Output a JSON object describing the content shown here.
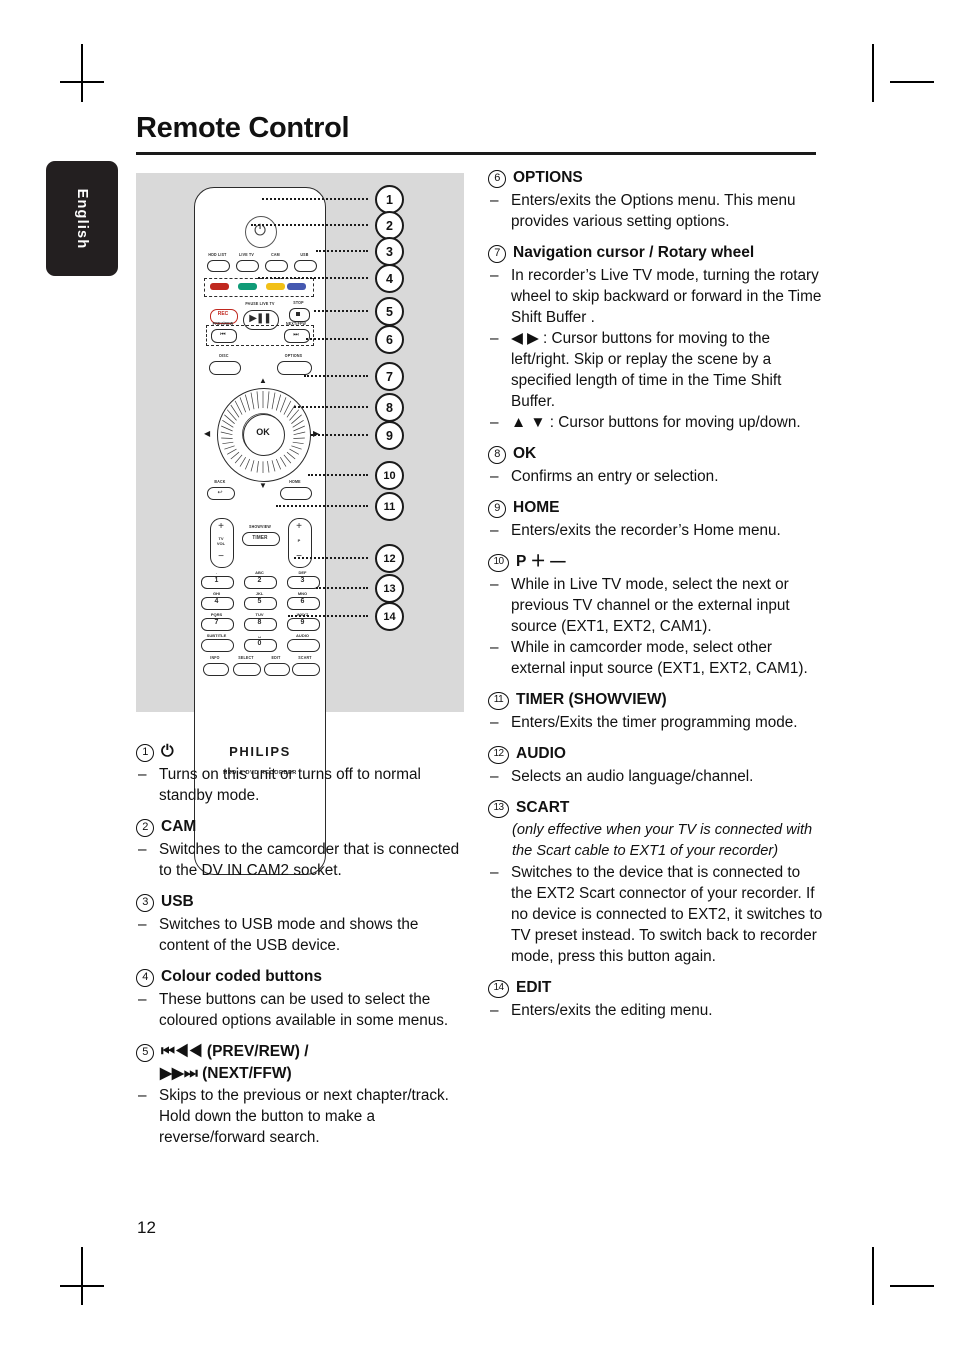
{
  "page": {
    "title": "Remote Control",
    "side_tab": "English",
    "number": "12"
  },
  "remote": {
    "brand": "PHILIPS",
    "model_line": "HDD & DVD RECORDER",
    "power_icon": "power-icon",
    "mode_buttons": [
      "HDD LIST",
      "LIVE TV",
      "CAM",
      "USB"
    ],
    "colour_buttons": [
      "#c0281f",
      "#0f9b77",
      "#f2c017",
      "#4558b0"
    ],
    "transport": {
      "rec": "REC",
      "pause_live_tv": "PAUSE LIVE TV",
      "stop": "STOP",
      "prev_rew": "PREV/REW",
      "next_ffw": "NEXT/FFW"
    },
    "disc": "DISC",
    "options": "OPTIONS",
    "ok": "OK",
    "back": "BACK",
    "home": "HOME",
    "tv_vol": "TV VOL",
    "showview": "SHOWVIEW",
    "timer": "TIMER",
    "prog": "P",
    "plus": "+",
    "minus": "−",
    "keypad": [
      {
        "digit": "1",
        "alpha": "."
      },
      {
        "digit": "2",
        "alpha": "ABC"
      },
      {
        "digit": "3",
        "alpha": "DEF"
      },
      {
        "digit": "4",
        "alpha": "GHI"
      },
      {
        "digit": "5",
        "alpha": "JKL"
      },
      {
        "digit": "6",
        "alpha": "MNO"
      },
      {
        "digit": "7",
        "alpha": "PQRS"
      },
      {
        "digit": "8",
        "alpha": "TUV"
      },
      {
        "digit": "9",
        "alpha": "WXYZ"
      },
      {
        "digit": "0",
        "alpha": "␣"
      }
    ],
    "subtitle": "SUBTITLE",
    "audio": "AUDIO",
    "info": "INFO",
    "select": "SELECT",
    "edit": "EDIT",
    "scart": "SCART"
  },
  "callouts": [
    "1",
    "2",
    "3",
    "4",
    "5",
    "6",
    "7",
    "8",
    "9",
    "10",
    "11",
    "12",
    "13",
    "14"
  ],
  "left_column": [
    {
      "num": "1",
      "title": "⏻",
      "title_is_glyph": true,
      "bullets": [
        "Turns on this unit or turns off to normal standby mode."
      ]
    },
    {
      "num": "2",
      "title": "CAM",
      "bullets": [
        "Switches to the camcorder that is connected to the DV IN CAM2 socket."
      ]
    },
    {
      "num": "3",
      "title": "USB",
      "bullets": [
        "Switches to USB mode and shows the content of the USB device."
      ]
    },
    {
      "num": "4",
      "title": "Colour coded buttons",
      "bullets": [
        "These buttons can be used to select the coloured options available in some menus."
      ]
    },
    {
      "num": "5",
      "title": "⏮◀◀  (PREV/REW) /",
      "title2": "▶▶⏭ (NEXT/FFW)",
      "bullets": [
        "Skips to the previous or next chapter/track. Hold down the button to make a reverse/forward search."
      ]
    }
  ],
  "right_column": [
    {
      "num": "6",
      "title": "OPTIONS",
      "bullets": [
        "Enters/exits the Options menu.  This menu provides various setting options."
      ]
    },
    {
      "num": "7",
      "title": "Navigation cursor / Rotary wheel",
      "bullets": [
        "In recorder’s Live TV mode, turning the rotary wheel to skip backward or forward in the Time Shift Buffer .",
        "◀ ▶ : Cursor buttons for moving to the left/right. Skip or replay the scene by a specified length of time in the Time Shift Buffer.",
        "▲ ▼ : Cursor buttons for moving up/down."
      ]
    },
    {
      "num": "8",
      "title": "OK",
      "bullets": [
        "Confirms an entry or selection."
      ]
    },
    {
      "num": "9",
      "title": "HOME",
      "bullets": [
        "Enters/exits the recorder’s Home menu."
      ]
    },
    {
      "num": "10",
      "title": "P ＋ —",
      "bullets": [
        "While in Live TV mode, select the next or previous TV channel or the external input source (EXT1, EXT2, CAM1).",
        "While in camcorder mode, select other external input source (EXT1, EXT2, CAM1)."
      ]
    },
    {
      "num": "11",
      "title": "TIMER (SHOWVIEW)",
      "bullets": [
        "Enters/Exits the timer programming mode."
      ]
    },
    {
      "num": "12",
      "title": "AUDIO",
      "bullets": [
        "Selects an audio language/channel."
      ]
    },
    {
      "num": "13",
      "title": "SCART",
      "note": "(only effective when your TV is connected with the Scart cable to EXT1 of your recorder)",
      "bullets": [
        "Switches to the device that is connected to the EXT2 Scart connector of your recorder.  If no device is connected to EXT2, it switches to TV preset instead. To switch back to recorder mode, press this button again."
      ]
    },
    {
      "num": "14",
      "title": "EDIT",
      "bullets": [
        "Enters/exits the editing menu."
      ]
    }
  ]
}
